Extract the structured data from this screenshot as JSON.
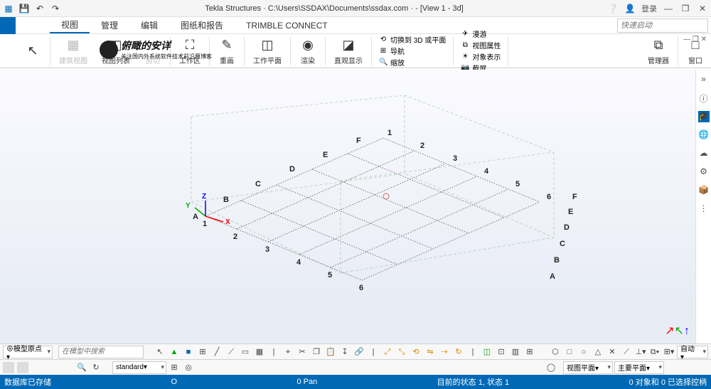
{
  "title": "Tekla Structures · C:\\Users\\SSDAX\\Documents\\ssdax.com · - [View 1 - 3d]",
  "menu": {
    "items": [
      "视图",
      "管理",
      "编辑",
      "图纸和报告",
      "TRIMBLE CONNECT"
    ],
    "active": 0
  },
  "quick_launch_placeholder": "快速启动",
  "login_label": "登录",
  "ribbon": {
    "groups": [
      {
        "icon": "↖",
        "label": "",
        "mini": true
      },
      {
        "icon": "▦",
        "label": "建筑视图",
        "disabled": true
      },
      {
        "icon": "◧",
        "label": "视图列表"
      },
      {
        "icon": "✂",
        "label": "剪切",
        "disabled": true
      },
      {
        "icon": "⛶",
        "label": "工作区"
      },
      {
        "icon": "✎",
        "label": "重画"
      },
      {
        "icon": "◫",
        "label": "工作平面"
      },
      {
        "icon": "◉",
        "label": "渲染"
      },
      {
        "icon": "◪",
        "label": "直观显示"
      }
    ],
    "mini_block1": [
      {
        "icon": "⟲",
        "label": "切换到 3D 或平面"
      },
      {
        "icon": "⊞",
        "label": "导航"
      },
      {
        "icon": "🔍",
        "label": "缩放"
      }
    ],
    "mini_block2": [
      {
        "icon": "✈",
        "label": "漫游"
      },
      {
        "icon": "⧉",
        "label": "视图属性"
      },
      {
        "icon": "☀",
        "label": "对象表示"
      },
      {
        "icon": "📷",
        "label": "截屏"
      }
    ],
    "right_groups": [
      {
        "icon": "⧉",
        "label": "管理器"
      },
      {
        "icon": "□",
        "label": "窗口"
      }
    ]
  },
  "watermark": {
    "main": "俯瞰的安详",
    "sub": "关注国内外系统软件技术前沿原博客"
  },
  "side_icons": [
    "»",
    "ⓘ",
    "🎓",
    "🌐",
    "☁",
    "⚙",
    "📦",
    "⋮"
  ],
  "grid_labels": {
    "letters": [
      "A",
      "B",
      "C",
      "D",
      "E",
      "F"
    ],
    "numbers": [
      "1",
      "2",
      "3",
      "4",
      "5",
      "6"
    ],
    "axes": [
      "X",
      "Y",
      "Z"
    ]
  },
  "toolbar1": {
    "origin_label": "⊕模型原点▾",
    "search_placeholder": "在模型中搜索",
    "right": {
      "view_plane": "视图平面▾",
      "main_plane": "主要平面▾"
    }
  },
  "toolbar2": {
    "std_label": "standard▾",
    "auto_label": "自动▾"
  },
  "status": {
    "left": "数据库已存储",
    "center": "O",
    "pan": "0 Pan",
    "state": "目前的状态 1, 状态 1",
    "right": "0 对象和 0 已选择控柄"
  }
}
